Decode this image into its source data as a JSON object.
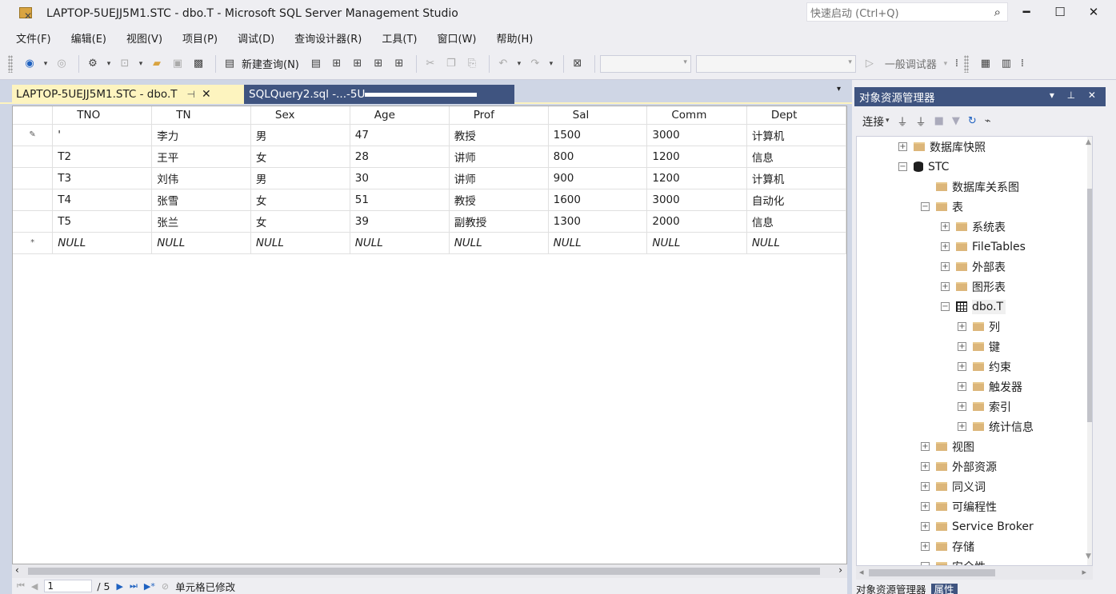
{
  "window": {
    "title": "LAPTOP-5UEJJ5M1.STC - dbo.T - Microsoft SQL Server Management Studio",
    "quick_launch_placeholder": "快速启动 (Ctrl+Q)"
  },
  "menu": [
    "文件(F)",
    "编辑(E)",
    "视图(V)",
    "项目(P)",
    "调试(D)",
    "查询设计器(R)",
    "工具(T)",
    "窗口(W)",
    "帮助(H)"
  ],
  "toolbar": {
    "new_query_label": "新建查询(N)",
    "debugger_label": "一般调试器"
  },
  "tabs": {
    "active": "LAPTOP-5UEJJ5M1.STC - dbo.T",
    "inactive": "SQLQuery2.sql -...-5U"
  },
  "grid": {
    "columns": [
      "TNO",
      "TN",
      "Sex",
      "Age",
      "Prof",
      "Sal",
      "Comm",
      "Dept"
    ],
    "rows": [
      [
        "'",
        "李力",
        "男",
        "47",
        "教授",
        "1500",
        "3000",
        "计算机"
      ],
      [
        "T2",
        "王平",
        "女",
        "28",
        "讲师",
        "800",
        "1200",
        "信息"
      ],
      [
        "T3",
        "刘伟",
        "男",
        "30",
        "讲师",
        "900",
        "1200",
        "计算机"
      ],
      [
        "T4",
        "张雪",
        "女",
        "51",
        "教授",
        "1600",
        "3000",
        "自动化"
      ],
      [
        "T5",
        "张兰",
        "女",
        "39",
        "副教授",
        "1300",
        "2000",
        "信息"
      ]
    ],
    "new_row": [
      "NULL",
      "NULL",
      "NULL",
      "NULL",
      "NULL",
      "NULL",
      "NULL",
      "NULL"
    ],
    "editing_marker": "✎",
    "new_row_marker": "*"
  },
  "navigator": {
    "current_record": "1",
    "total": "/ 5",
    "status": "单元格已修改"
  },
  "object_explorer": {
    "title": "对象资源管理器",
    "connect_label": "连接",
    "tree": [
      {
        "label": "数据库快照",
        "level": 1,
        "expand": "plus",
        "icon": "folder"
      },
      {
        "label": "STC",
        "level": 1,
        "expand": "minus",
        "icon": "database"
      },
      {
        "label": "数据库关系图",
        "level": 2,
        "expand": "none",
        "icon": "folder"
      },
      {
        "label": "表",
        "level": 2,
        "expand": "minus",
        "icon": "folder"
      },
      {
        "label": "系统表",
        "level": 3,
        "expand": "plus",
        "icon": "folder"
      },
      {
        "label": "FileTables",
        "level": 3,
        "expand": "plus",
        "icon": "folder"
      },
      {
        "label": "外部表",
        "level": 3,
        "expand": "plus",
        "icon": "folder"
      },
      {
        "label": "图形表",
        "level": 3,
        "expand": "plus",
        "icon": "folder"
      },
      {
        "label": "dbo.T",
        "level": 3,
        "expand": "minus",
        "icon": "table"
      },
      {
        "label": "列",
        "level": 4,
        "expand": "plus",
        "icon": "folder"
      },
      {
        "label": "键",
        "level": 4,
        "expand": "plus",
        "icon": "folder"
      },
      {
        "label": "约束",
        "level": 4,
        "expand": "plus",
        "icon": "folder"
      },
      {
        "label": "触发器",
        "level": 4,
        "expand": "plus",
        "icon": "folder"
      },
      {
        "label": "索引",
        "level": 4,
        "expand": "plus",
        "icon": "folder"
      },
      {
        "label": "统计信息",
        "level": 4,
        "expand": "plus",
        "icon": "folder"
      },
      {
        "label": "视图",
        "level": 2,
        "expand": "plus",
        "icon": "folder"
      },
      {
        "label": "外部资源",
        "level": 2,
        "expand": "plus",
        "icon": "folder"
      },
      {
        "label": "同义词",
        "level": 2,
        "expand": "plus",
        "icon": "folder"
      },
      {
        "label": "可编程性",
        "level": 2,
        "expand": "plus",
        "icon": "folder"
      },
      {
        "label": "Service Broker",
        "level": 2,
        "expand": "plus",
        "icon": "folder"
      },
      {
        "label": "存储",
        "level": 2,
        "expand": "plus",
        "icon": "folder"
      },
      {
        "label": "安全性",
        "level": 2,
        "expand": "minus",
        "icon": "folder"
      }
    ],
    "bottom_tab_active": "对象资源管理器",
    "bottom_tab_other": "属性"
  }
}
